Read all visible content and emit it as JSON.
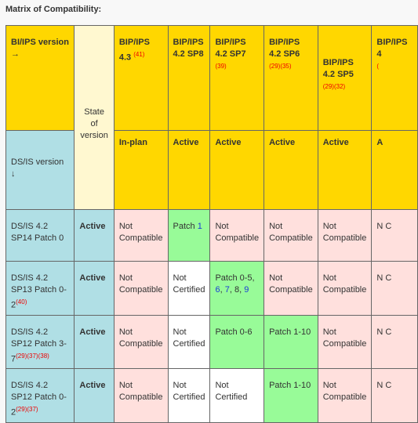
{
  "title": "Matrix of Compatibility:",
  "header": {
    "bi_label": "BI/IPS version →",
    "ds_label": "DS/IS version ↓",
    "state_label": "State of version",
    "columns": [
      {
        "name": "BIP/IPS 4.3",
        "refs": "(41)",
        "state": "In-plan"
      },
      {
        "name": "BIP/IPS 4.2 SP8",
        "refs": "",
        "state": "Active"
      },
      {
        "name": "BIP/IPS 4.2 SP7",
        "refs": "(39)",
        "state": "Active"
      },
      {
        "name": "BIP/IPS 4.2 SP6",
        "refs": "(29)(35)",
        "state": "Active"
      },
      {
        "name": "BIP/IPS 4.2 SP5",
        "refs": "(29)(32)",
        "state": "Active"
      },
      {
        "name": "BIP/IPS 4",
        "refs": "(",
        "state": "A"
      }
    ]
  },
  "rows": [
    {
      "version": "DS/IS 4.2 SP14 Patch 0",
      "refs": "",
      "state": "Active",
      "cells": [
        {
          "t": "Not Compatible",
          "c": "nc"
        },
        {
          "t": "Patch ",
          "link": "1",
          "c": "g"
        },
        {
          "t": "Not Compatible",
          "c": "nc"
        },
        {
          "t": "Not Compatible",
          "c": "nc"
        },
        {
          "t": "Not Compatible",
          "c": "nc"
        },
        {
          "t": "N C",
          "c": "nc"
        }
      ]
    },
    {
      "version": "DS/IS 4.2 SP13 Patch 0-2",
      "refs": "(40)",
      "state": "Active",
      "cells": [
        {
          "t": "Not Compatible",
          "c": "nc"
        },
        {
          "t": "Not Certified",
          "c": "w"
        },
        {
          "t": "Patch 0-5,",
          "c": "g",
          "extra": true
        },
        {
          "t": "Not Compatible",
          "c": "nc"
        },
        {
          "t": "Not Compatible",
          "c": "nc"
        },
        {
          "t": "N C",
          "c": "nc"
        }
      ]
    },
    {
      "version": "DS/IS 4.2 SP12 Patch 3-7",
      "refs": "(29)(37)(38)",
      "state": "Active",
      "cells": [
        {
          "t": "Not Compatible",
          "c": "nc"
        },
        {
          "t": "Not Certified",
          "c": "w"
        },
        {
          "t": "Patch 0-6",
          "c": "g"
        },
        {
          "t": "Patch 1-10",
          "c": "g"
        },
        {
          "t": "Not Compatible",
          "c": "nc"
        },
        {
          "t": "N C",
          "c": "nc"
        }
      ]
    },
    {
      "version": "DS/IS 4.2 SP12 Patch 0-2",
      "refs": "(29)(37)",
      "state": "Active",
      "cells": [
        {
          "t": "Not Compatible",
          "c": "nc"
        },
        {
          "t": "Not Certified",
          "c": "w"
        },
        {
          "t": "Not Certified",
          "c": "w"
        },
        {
          "t": "Patch 1-10",
          "c": "g"
        },
        {
          "t": "Not Compatible",
          "c": "nc"
        },
        {
          "t": "N C",
          "c": "nc"
        }
      ]
    }
  ],
  "patch_links": {
    "p6": "6",
    "p7": "7",
    "p8": "8",
    "p9": "9"
  },
  "colors": {
    "header": "#ffd700",
    "ds_column": "#b0dfe5",
    "not_compatible": "#ffe0dd",
    "compatible": "#98fb98",
    "reference": "#e00000",
    "link": "#1a3cd8"
  }
}
